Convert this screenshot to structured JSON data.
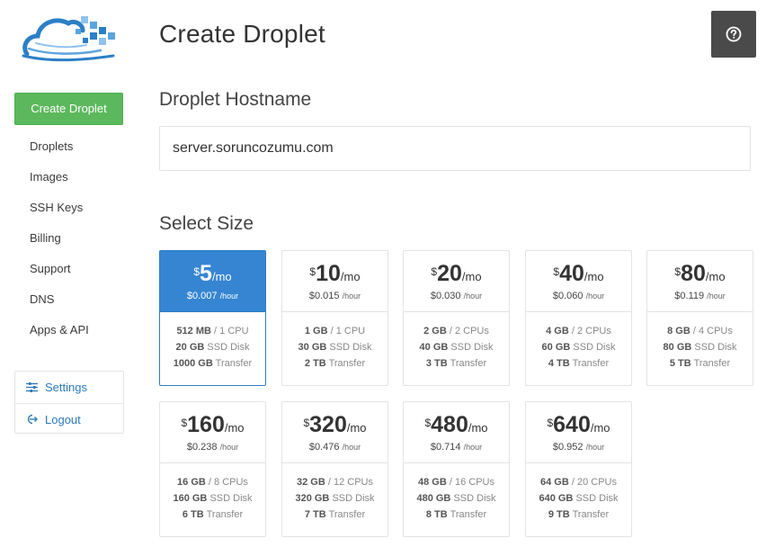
{
  "header": {
    "title": "Create Droplet",
    "help_icon": "question-circle-icon"
  },
  "sidebar": {
    "create_label": "Create Droplet",
    "items": [
      {
        "label": "Droplets"
      },
      {
        "label": "Images"
      },
      {
        "label": "SSH Keys"
      },
      {
        "label": "Billing"
      },
      {
        "label": "Support"
      },
      {
        "label": "DNS"
      },
      {
        "label": "Apps & API"
      }
    ],
    "settings_label": "Settings",
    "logout_label": "Logout"
  },
  "hostname": {
    "title": "Droplet Hostname",
    "value": "server.soruncozumu.com"
  },
  "sizes": {
    "title": "Select Size",
    "selected_index": 0,
    "currency": "$",
    "per_month": "/mo",
    "per_hour": "/hour",
    "cpu_label": "CPU",
    "cpus_label": "CPUs",
    "disk_label": "SSD Disk",
    "transfer_label": "Transfer",
    "plans": [
      {
        "price": "5",
        "hourly": "$0.007",
        "ram": "512 MB",
        "cpus": "1",
        "cpu_word": "CPU",
        "disk": "20 GB",
        "transfer": "1000 GB"
      },
      {
        "price": "10",
        "hourly": "$0.015",
        "ram": "1 GB",
        "cpus": "1",
        "cpu_word": "CPU",
        "disk": "30 GB",
        "transfer": "2 TB"
      },
      {
        "price": "20",
        "hourly": "$0.030",
        "ram": "2 GB",
        "cpus": "2",
        "cpu_word": "CPUs",
        "disk": "40 GB",
        "transfer": "3 TB"
      },
      {
        "price": "40",
        "hourly": "$0.060",
        "ram": "4 GB",
        "cpus": "2",
        "cpu_word": "CPUs",
        "disk": "60 GB",
        "transfer": "4 TB"
      },
      {
        "price": "80",
        "hourly": "$0.119",
        "ram": "8 GB",
        "cpus": "4",
        "cpu_word": "CPUs",
        "disk": "80 GB",
        "transfer": "5 TB"
      },
      {
        "price": "160",
        "hourly": "$0.238",
        "ram": "16 GB",
        "cpus": "8",
        "cpu_word": "CPUs",
        "disk": "160 GB",
        "transfer": "6 TB"
      },
      {
        "price": "320",
        "hourly": "$0.476",
        "ram": "32 GB",
        "cpus": "12",
        "cpu_word": "CPUs",
        "disk": "320 GB",
        "transfer": "7 TB"
      },
      {
        "price": "480",
        "hourly": "$0.714",
        "ram": "48 GB",
        "cpus": "16",
        "cpu_word": "CPUs",
        "disk": "480 GB",
        "transfer": "8 TB"
      },
      {
        "price": "640",
        "hourly": "$0.952",
        "ram": "64 GB",
        "cpus": "20",
        "cpu_word": "CPUs",
        "disk": "640 GB",
        "transfer": "9 TB"
      }
    ]
  },
  "colors": {
    "accent_blue": "#3585d2",
    "create_green": "#5cb85c",
    "link_blue": "#2c7bb6",
    "help_button": "#4a4a4a"
  }
}
